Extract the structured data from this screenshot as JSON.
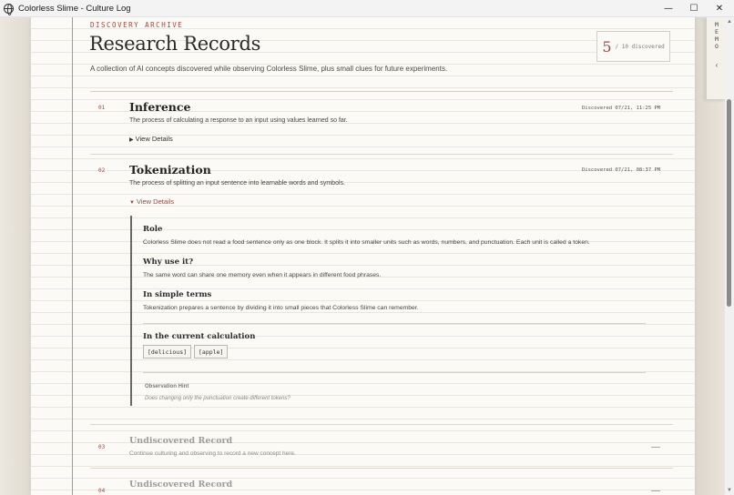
{
  "window": {
    "title": "Colorless Slime - Culture Log",
    "minimize": "—",
    "maximize": "☐",
    "close": "✕"
  },
  "header": {
    "kicker": "DISCOVERY ARCHIVE",
    "title": "Research Records",
    "subtitle": "A collection of AI concepts discovered while observing Colorless Slime, plus small clues for future experiments.",
    "counter": {
      "discovered": "5",
      "total_label": "/ 10 discovered"
    }
  },
  "memo_tab": {
    "label": "M\nE\nM\nO",
    "chevron": "‹"
  },
  "entries": [
    {
      "num": "01",
      "title": "Inference",
      "date": "Discovered 07/21, 11:25 PM",
      "desc": "The process of calculating a response to an input using values learned so far.",
      "toggle": "View Details",
      "expanded": false
    },
    {
      "num": "02",
      "title": "Tokenization",
      "date": "Discovered 07/21, 08:37 PM",
      "desc": "The process of splitting an input sentence into learnable words and symbols.",
      "toggle": "View Details",
      "expanded": true,
      "details": {
        "role_h": "Role",
        "role_p": "Colorless Slime does not read a food sentence only as one block. It splits it into smaller units such as words, numbers, and punctuation. Each unit is called a token.",
        "why_h": "Why use it?",
        "why_p": "The same word can share one memory even when it appears in different food phrases.",
        "simple_h": "In simple terms",
        "simple_p": "Tokenization prepares a sentence by dividing it into small pieces that Colorless Slime can remember.",
        "calc_h": "In the current calculation",
        "tokens": [
          "[delicious]",
          "[apple]"
        ],
        "hint_label": "Observation Hint",
        "hint_text": "Does changing only the punctuation create different tokens?"
      }
    }
  ],
  "undiscovered": [
    {
      "num": "03",
      "title": "Undiscovered Record",
      "desc": "Continue culturing and observing to record a new concept here."
    },
    {
      "num": "04",
      "title": "Undiscovered Record",
      "desc": ""
    }
  ]
}
